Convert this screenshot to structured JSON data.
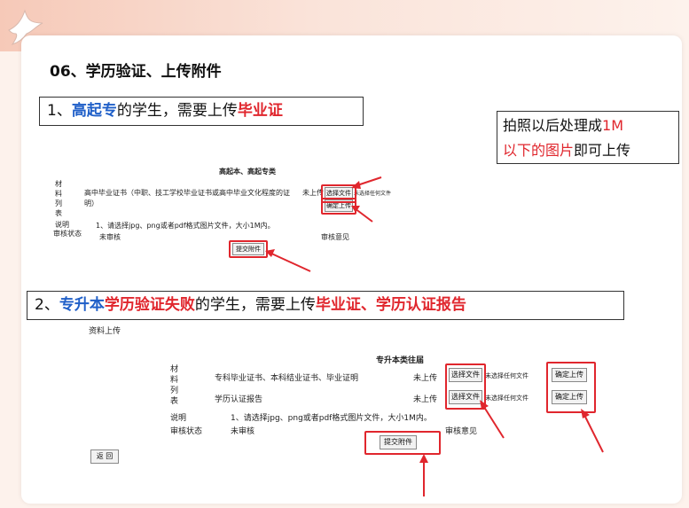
{
  "slide": {
    "heading": "06、学历验证、上传附件",
    "note": {
      "part1": "拍照以后处理成",
      "part2": "1M",
      "part3": "以下的图片",
      "part4": "即可上传"
    }
  },
  "section1": {
    "prefix": "1、",
    "highlight1": "高起专",
    "middle": "的学生，需要上传",
    "highlight2": "毕业证",
    "screenshot": {
      "title": "高起本、高起专类",
      "materials_label": "材料列表",
      "row_text": "高中毕业证书（中职、技工学校毕业证书或高中毕业文化程度的证明）",
      "status": "未上传",
      "choose_file": "选择文件",
      "no_file": "未选择任何文件",
      "confirm_upload": "确定上传",
      "desc_label": "说明",
      "desc_text": "1、请选择jpg、png或者pdf格式图片文件，大小1M内。",
      "review_status_label": "审核状态",
      "review_status_value": "未审核",
      "review_opinion": "审核意见",
      "submit": "提交附件"
    }
  },
  "section2": {
    "prefix": "2、",
    "highlight1": "专升本",
    "highlight2": "学历验证失败",
    "middle": "的学生，需要上传",
    "highlight3": "毕业证、学历认证报告",
    "screenshot": {
      "header": "资料上传",
      "title": "专升本类往届",
      "materials_label": "材料列表",
      "row1_text": "专科毕业证书、本科结业证书、毕业证明",
      "row2_text": "学历认证报告",
      "status1": "未上传",
      "status2": "未上传",
      "choose_file": "选择文件",
      "no_file": "未选择任何文件",
      "confirm_upload": "确定上传",
      "desc_label": "说明",
      "desc_text": "1、请选择jpg、png或者pdf格式图片文件，大小1M内。",
      "review_status_label": "审核状态",
      "review_status_value": "未审核",
      "review_opinion": "审核意见",
      "submit": "提交附件",
      "back": "返  回"
    }
  },
  "colors": {
    "accent_red": "#e0262d",
    "accent_blue": "#1f5fc8"
  }
}
